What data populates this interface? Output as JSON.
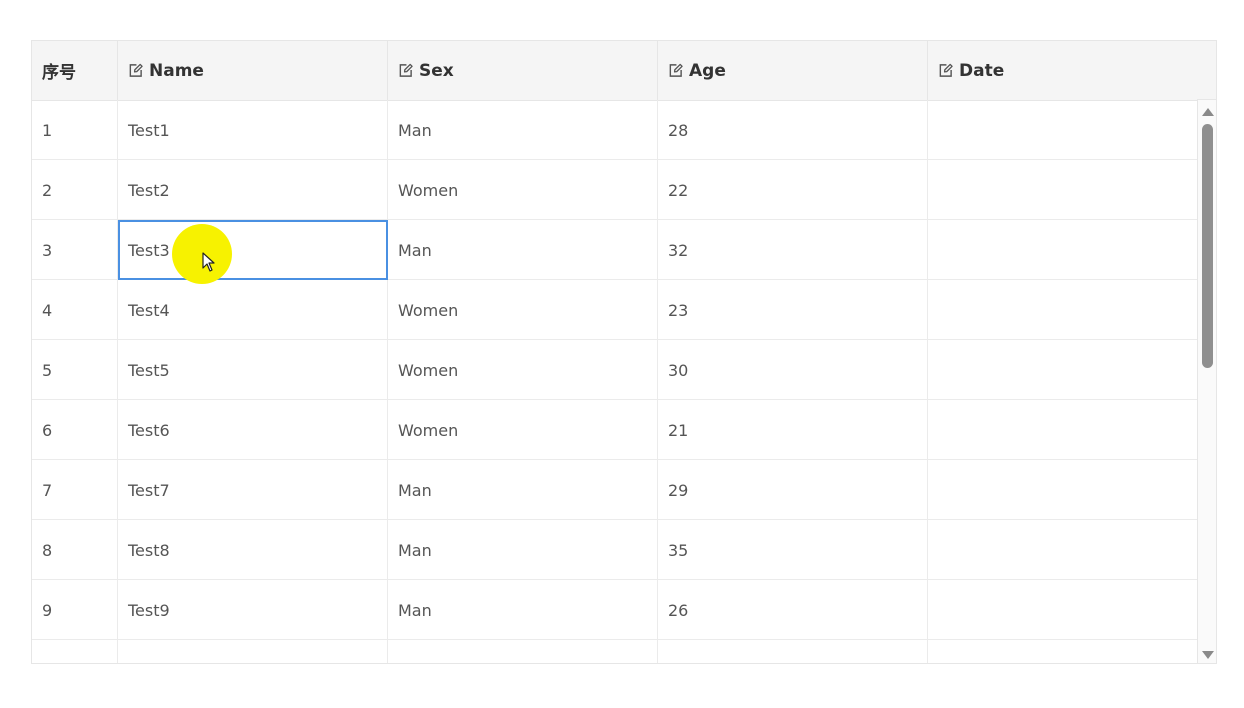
{
  "columns": [
    {
      "label": "序号",
      "editable": false
    },
    {
      "label": "Name",
      "editable": true
    },
    {
      "label": "Sex",
      "editable": true
    },
    {
      "label": "Age",
      "editable": true
    },
    {
      "label": "Date",
      "editable": true
    }
  ],
  "rows": [
    [
      "1",
      "Test1",
      "Man",
      "28",
      ""
    ],
    [
      "2",
      "Test2",
      "Women",
      "22",
      ""
    ],
    [
      "3",
      "Test3",
      "Man",
      "32",
      ""
    ],
    [
      "4",
      "Test4",
      "Women",
      "23",
      ""
    ],
    [
      "5",
      "Test5",
      "Women",
      "30",
      ""
    ],
    [
      "6",
      "Test6",
      "Women",
      "21",
      ""
    ],
    [
      "7",
      "Test7",
      "Man",
      "29",
      ""
    ],
    [
      "8",
      "Test8",
      "Man",
      "35",
      ""
    ],
    [
      "9",
      "Test9",
      "Man",
      "26",
      ""
    ],
    [
      "",
      "",
      "",
      "",
      ""
    ]
  ],
  "selected_cell": {
    "row": 2,
    "col": 1
  },
  "colors": {
    "selection_border": "#4a90e2",
    "cursor_highlight": "#f7f200"
  },
  "icons": {
    "header_edit": "edit-icon",
    "scroll_up": "triangle-up-icon",
    "scroll_down": "triangle-down-icon",
    "cursor": "mouse-pointer-icon"
  }
}
